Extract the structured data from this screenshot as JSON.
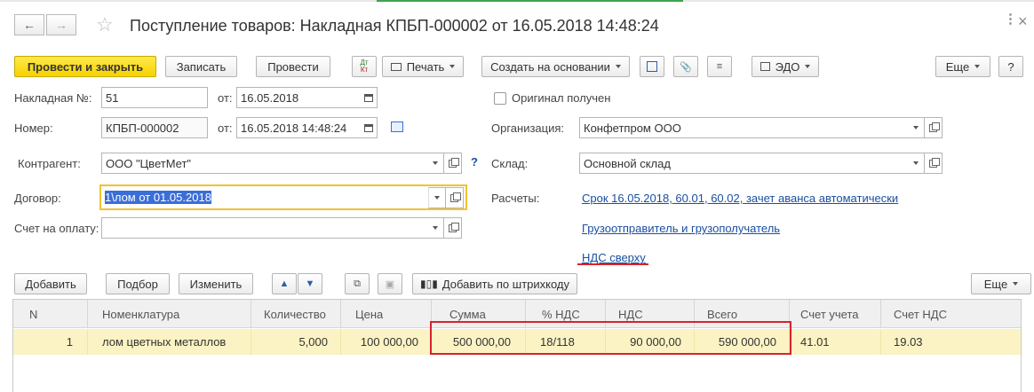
{
  "window": {
    "title": "Поступление товаров: Накладная КПБП-000002 от 16.05.2018 14:48:24",
    "back_icon": "arrow-left-icon",
    "forward_icon": "arrow-right-icon",
    "favorite_icon": "star-icon",
    "more_glyph": "⋮",
    "close_glyph": "×"
  },
  "toolbar": {
    "post_close": "Провести и закрыть",
    "save": "Записать",
    "post": "Провести",
    "dtkt_top": "Дт",
    "dtkt_bottom": "Кт",
    "print": "Печать",
    "create_based": "Создать на основании",
    "edo": "ЭДО",
    "more": "Еще",
    "help": "?"
  },
  "form": {
    "invoice_no_label": "Накладная №:",
    "invoice_no_value": "51",
    "from_label": "от:",
    "invoice_date": "16.05.2018",
    "original_received": "Оригинал получен",
    "number_label": "Номер:",
    "number_value": "КПБП-000002",
    "number_datetime": "16.05.2018 14:48:24",
    "organization_label": "Организация:",
    "organization_value": "Конфетпром ООО",
    "counterparty_label": "Контрагент:",
    "counterparty_value": "ООО \"ЦветМет\"",
    "question_mark": "?",
    "warehouse_label": "Склад:",
    "warehouse_value": "Основной склад",
    "contract_label": "Договор:",
    "contract_value": "1\\лом от 01.05.2018",
    "settlements_label": "Расчеты:",
    "settlements_link": "Срок 16.05.2018, 60.01, 60.02, зачет аванса автоматически",
    "payment_invoice_label": "Счет на оплату:",
    "payment_invoice_value": "",
    "shipper_link": "Грузоотправитель и грузополучатель",
    "vat_link": "НДС сверху"
  },
  "table_toolbar": {
    "add": "Добавить",
    "select": "Подбор",
    "change": "Изменить",
    "add_barcode": "Добавить по штрихкоду",
    "more": "Еще"
  },
  "table": {
    "columns": [
      "N",
      "Номенклатура",
      "Количество",
      "Цена",
      "Сумма",
      "% НДС",
      "НДС",
      "Всего",
      "Счет учета",
      "Счет НДС"
    ],
    "rows": [
      [
        "1",
        "лом цветных металлов",
        "5,000",
        "100 000,00",
        "500 000,00",
        "18/118",
        "90 000,00",
        "590 000,00",
        "41.01",
        "19.03"
      ]
    ]
  },
  "colors": {
    "primary_button": "#f6d300",
    "link": "#1a4fa0",
    "highlight_row": "#fbf3c3",
    "annotation_red": "#d9232d"
  }
}
